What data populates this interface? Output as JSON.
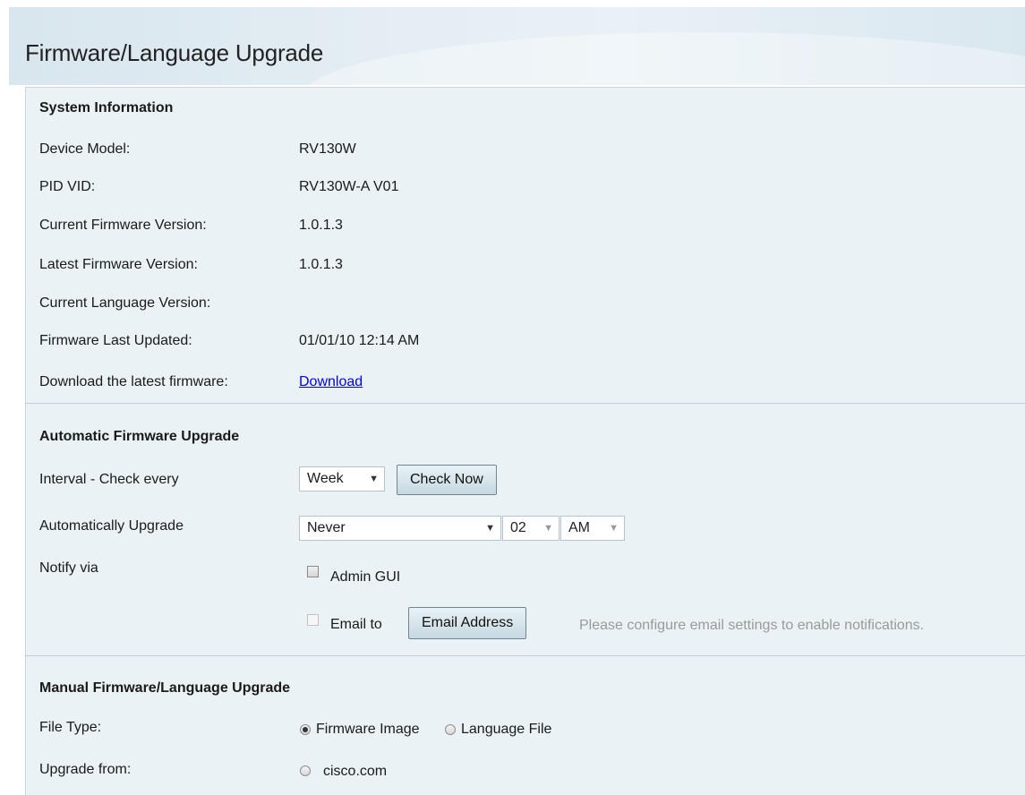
{
  "page": {
    "title": "Firmware/Language Upgrade"
  },
  "system_info": {
    "heading": "System Information",
    "rows": [
      {
        "label": "Device Model:",
        "value": "RV130W"
      },
      {
        "label": "PID VID:",
        "value": "RV130W-A V01"
      },
      {
        "label": "Current Firmware Version:",
        "value": "1.0.1.3"
      },
      {
        "label": "Latest Firmware Version:",
        "value": "1.0.1.3"
      },
      {
        "label": "Current Language Version:",
        "value": ""
      },
      {
        "label": "Firmware Last Updated:",
        "value": "01/01/10 12:14 AM"
      }
    ],
    "download_label": "Download the latest firmware:",
    "download_link": "Download"
  },
  "auto_upgrade": {
    "heading": "Automatic Firmware Upgrade",
    "interval_label": "Interval - Check every",
    "interval_value": "Week",
    "check_now": "Check Now",
    "auto_label": "Automatically Upgrade",
    "auto_value": "Never",
    "hour_value": "02",
    "ampm_value": "AM",
    "notify_label": "Notify via",
    "admin_gui": "Admin GUI",
    "email_to": "Email to",
    "email_button": "Email Address",
    "email_hint": "Please configure email settings to enable notifications."
  },
  "manual_upgrade": {
    "heading": "Manual Firmware/Language Upgrade",
    "file_type_label": "File Type:",
    "firmware_image": "Firmware Image",
    "language_file": "Language File",
    "upgrade_from_label": "Upgrade from:",
    "cisco_com": "cisco.com"
  },
  "icons": {
    "dropdown": "▼"
  }
}
